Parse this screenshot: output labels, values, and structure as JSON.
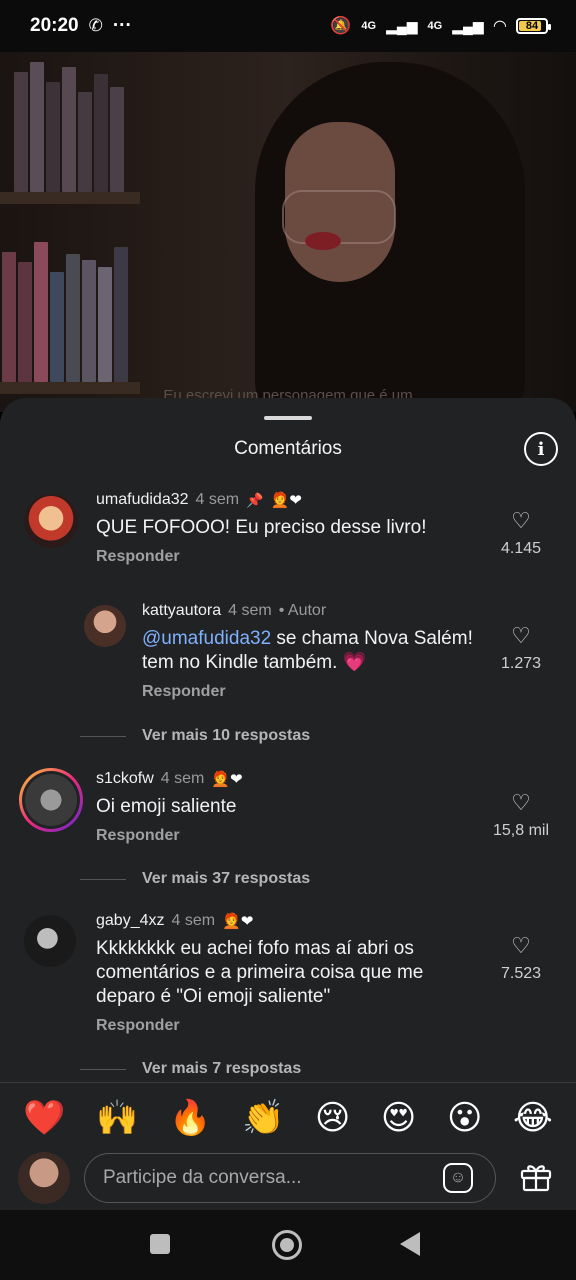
{
  "status": {
    "time": "20:20",
    "net1": "4G",
    "net2": "4G",
    "battery": "84",
    "battery_level": 0.84
  },
  "video": {
    "caption": "Eu escrevi um personagem que é um"
  },
  "sheet": {
    "title": "Comentários"
  },
  "comments": [
    {
      "user": "umafudida32",
      "time": "4 sem",
      "text": "QUE FOFOOO! Eu preciso desse livro!",
      "reply": "Responder",
      "likes": "4.145",
      "more": ""
    },
    {
      "user": "kattyautora",
      "time": "4 sem",
      "author": "• Autor",
      "mention": "@umafudida32",
      "text": " se chama Nova Salém! tem no Kindle também. 💗",
      "reply": "Responder",
      "likes": "1.273",
      "more": "Ver mais 10 respostas"
    },
    {
      "user": "s1ckofw",
      "time": "4 sem",
      "text": "Oi emoji saliente",
      "reply": "Responder",
      "likes": "15,8 mil",
      "more": "Ver mais 37 respostas"
    },
    {
      "user": "gaby_4xz",
      "time": "4 sem",
      "text": "Kkkkkkkk eu achei fofo mas aí abri os comentários e a primeira coisa que me deparo é \"Oi emoji saliente\"",
      "reply": "Responder",
      "likes": "7.523",
      "more": "Ver mais 7 respostas"
    }
  ],
  "reactions": [
    "❤️",
    "🙌",
    "🔥",
    "👏",
    "😢",
    "😍",
    "😮",
    "😂"
  ],
  "composer": {
    "placeholder": "Participe da conversa..."
  },
  "colors": {
    "sheet_bg": "#202224",
    "mention": "#7fb1ff"
  }
}
